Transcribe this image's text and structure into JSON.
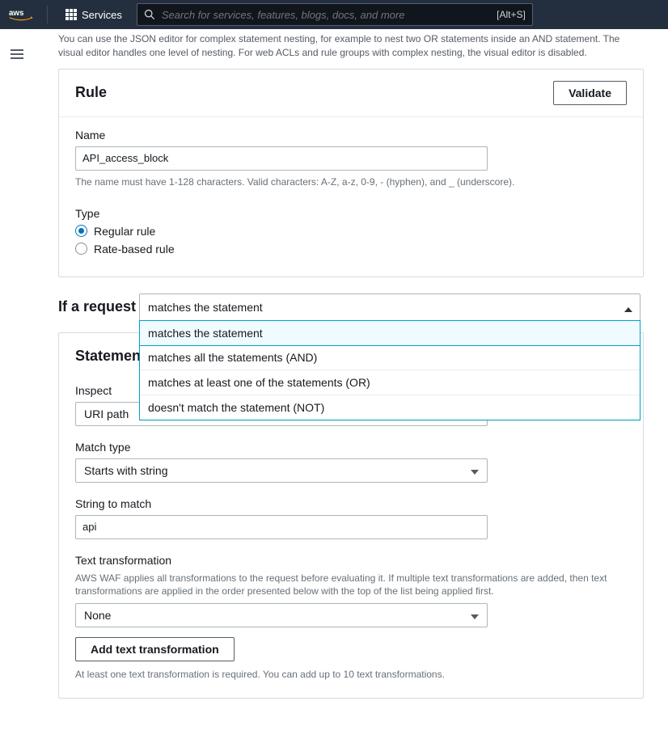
{
  "topbar": {
    "services_label": "Services",
    "search_placeholder": "Search for services, features, blogs, docs, and more",
    "shortcut_hint": "[Alt+S]"
  },
  "intro_text": "You can use the JSON editor for complex statement nesting, for example to nest two OR statements inside an AND statement. The visual editor handles one level of nesting. For web ACLs and rule groups with complex nesting, the visual editor is disabled.",
  "rule_panel": {
    "title": "Rule",
    "validate_button": "Validate",
    "name_label": "Name",
    "name_value": "API_access_block",
    "name_help": "The name must have 1-128 characters. Valid characters: A-Z, a-z, 0-9, - (hyphen), and _ (underscore).",
    "type_label": "Type",
    "type_options": {
      "regular": "Regular rule",
      "rate": "Rate-based rule"
    }
  },
  "if_request": {
    "lead": "If a request",
    "selected": "matches the statement",
    "options": [
      "matches the statement",
      "matches all the statements (AND)",
      "matches at least one of the statements (OR)",
      "doesn't match the statement (NOT)"
    ]
  },
  "statement_panel": {
    "title": "Statement",
    "inspect_label": "Inspect",
    "inspect_value": "URI path",
    "match_type_label": "Match type",
    "match_type_value": "Starts with string",
    "string_label": "String to match",
    "string_value": "api",
    "tt_label": "Text transformation",
    "tt_help": "AWS WAF applies all transformations to the request before evaluating it. If multiple text transformations are added, then text transformations are applied in the order presented below with the top of the list being applied first.",
    "tt_value": "None",
    "add_tt_button": "Add text transformation",
    "tt_footer": "At least one text transformation is required. You can add up to 10 text transformations."
  }
}
